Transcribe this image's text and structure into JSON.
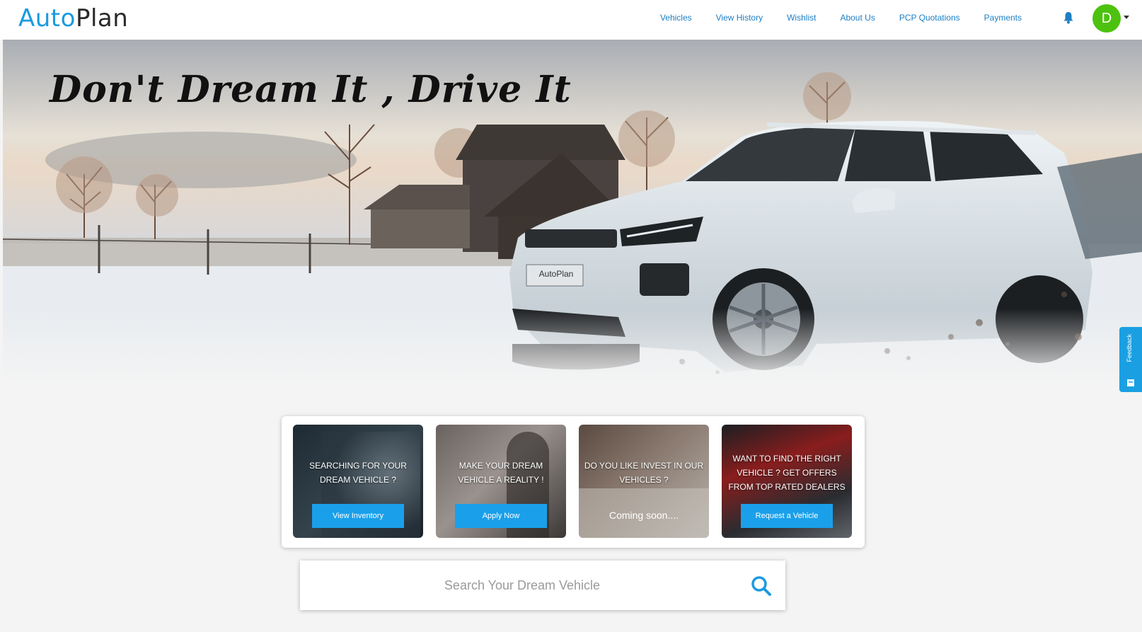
{
  "brand": {
    "logo_part1": "Auto",
    "logo_part2": "Plan",
    "accent_color": "#1a9ae0"
  },
  "nav": {
    "items": [
      {
        "label": "Vehicles"
      },
      {
        "label": "View History"
      },
      {
        "label": "Wishlist"
      },
      {
        "label": "About Us"
      },
      {
        "label": "PCP Quotations"
      },
      {
        "label": "Payments"
      }
    ],
    "notification_icon": "bell-icon",
    "user_initial": "D",
    "avatar_color": "#4cc20f"
  },
  "hero": {
    "slogan": "Don't Dream It , Drive It",
    "plate_text": "AutoPlan"
  },
  "feedback_tab": {
    "label": "Feedback"
  },
  "cards": [
    {
      "text": "Searching for your dream vehicle ?",
      "button": "View Inventory"
    },
    {
      "text": "Make your dream vehicle a reality !",
      "button": "Apply Now"
    },
    {
      "text": "Do you like invest in our vehicles ?",
      "status": "Coming soon...."
    },
    {
      "text": "Want to find the right vehicle ? Get offers from top rated dealers",
      "button": "Request a Vehicle"
    }
  ],
  "search": {
    "placeholder": "Search Your Dream Vehicle",
    "icon": "search-icon",
    "button_color": "#1a9ae0"
  }
}
